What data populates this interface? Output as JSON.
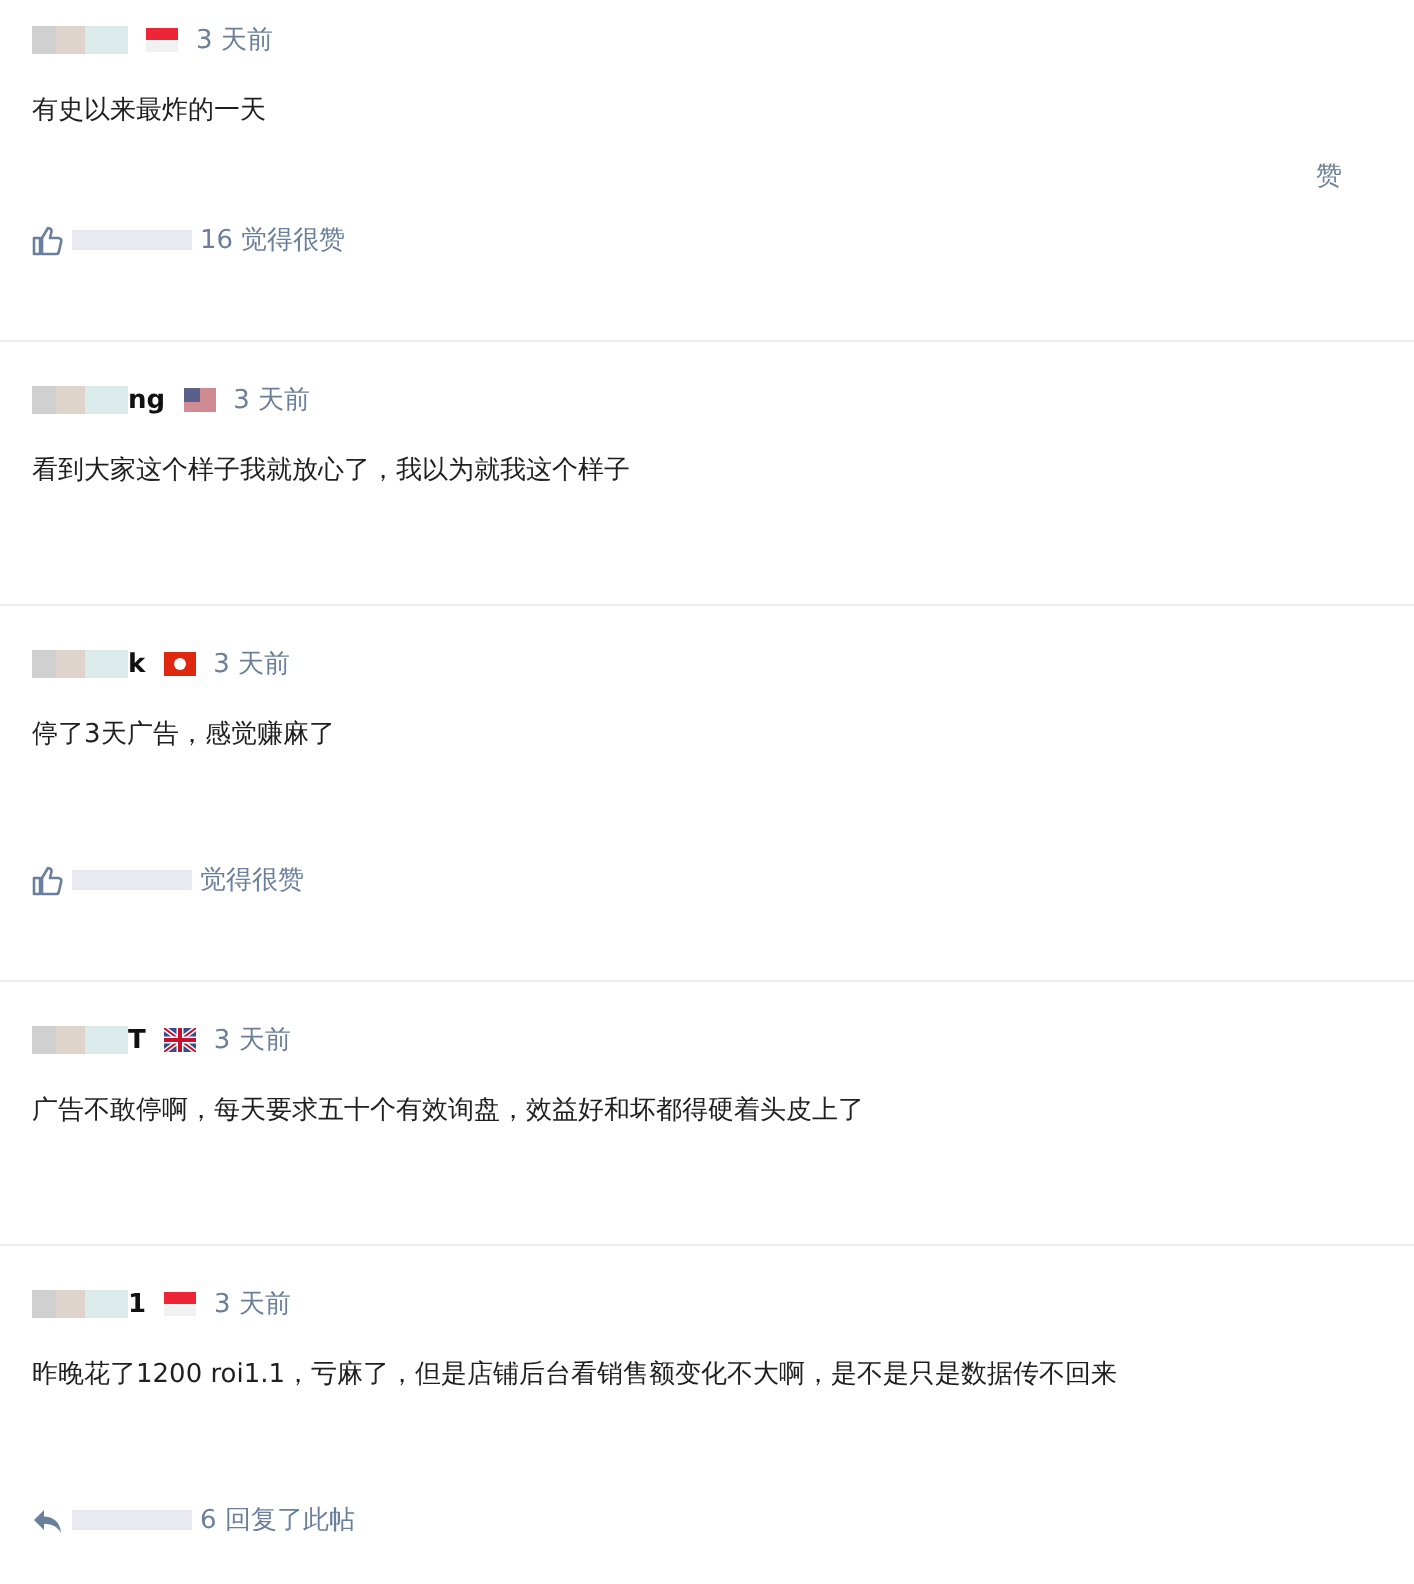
{
  "comments": [
    {
      "author_redacted": true,
      "flag": {
        "kind": "sg"
      },
      "time": "3 天前",
      "text": "有史以来最炸的一天",
      "actions": [
        "赞"
      ],
      "footer": {
        "kind": "liked",
        "text": "16 觉得很赞",
        "redacted": true
      }
    },
    {
      "author": "ng",
      "author_redacted": true,
      "flag": {
        "kind": "us"
      },
      "time": "3 天前",
      "text": "看到大家这个样子我就放心了，我以为就我这个样子"
    },
    {
      "author": "k",
      "author_redacted": true,
      "flag": {
        "kind": "hk"
      },
      "time": "3 天前",
      "text": "停了3天广告，感觉赚麻了",
      "footer": {
        "kind": "liked",
        "text": "觉得很赞",
        "redacted": true
      }
    },
    {
      "author": "T",
      "author_redacted": true,
      "flag": {
        "kind": "gb"
      },
      "time": "3 天前",
      "text": "广告不敢停啊，每天要求五十个有效询盘，效益好和坏都得硬着头皮上了"
    },
    {
      "author": "1",
      "author_redacted": true,
      "flag": {
        "kind": "sg"
      },
      "time": "3 天前",
      "text": "昨晚花了1200 roi1.1，亏麻了，但是店铺后台看销售额变化不大啊，是不是只是数据传不回来",
      "footer": {
        "kind": "replied",
        "text": "6 回复了此帖",
        "redacted": true
      }
    }
  ]
}
